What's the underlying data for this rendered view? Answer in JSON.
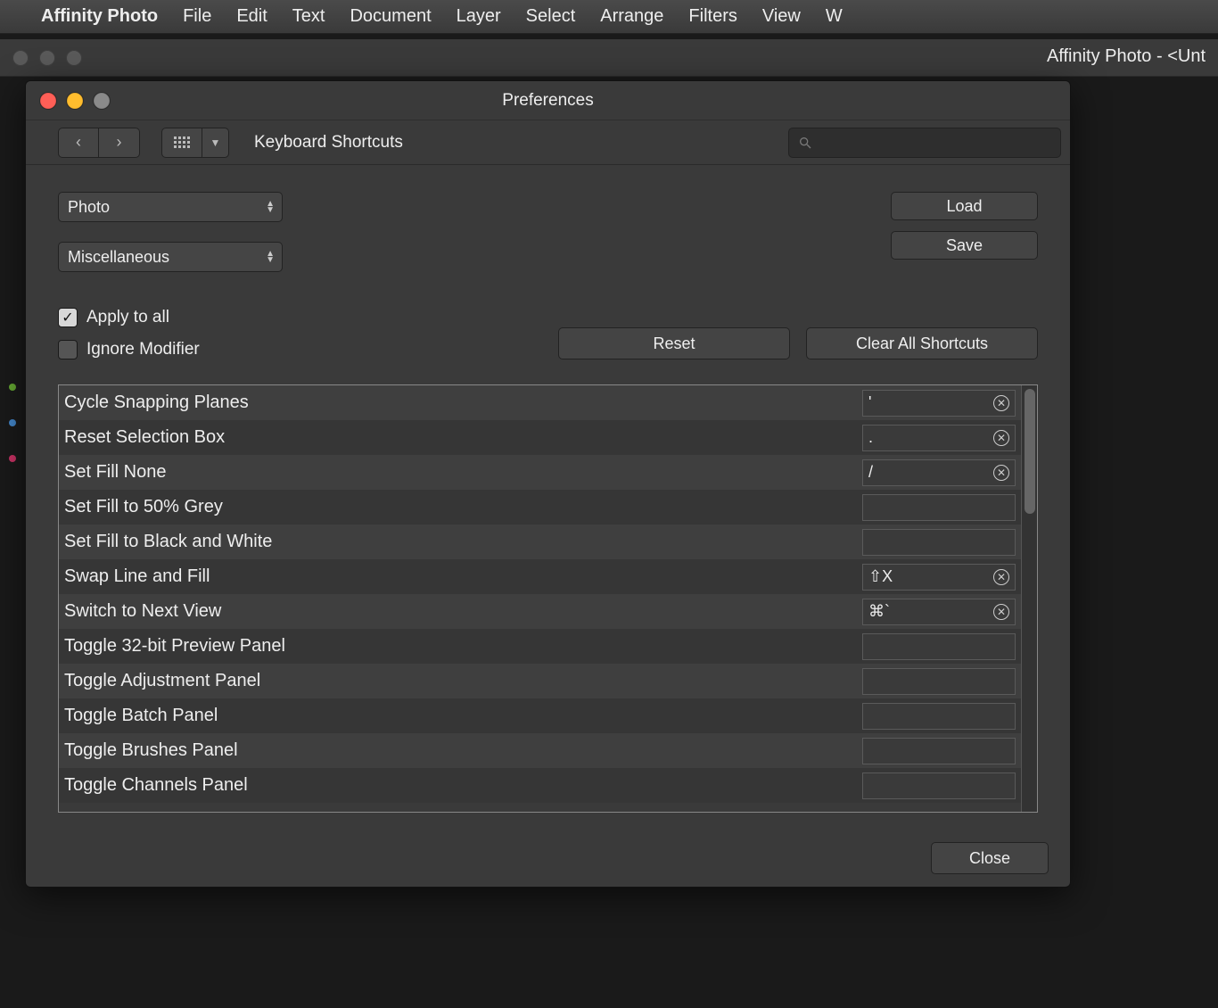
{
  "menubar": {
    "app": "Affinity Photo",
    "items": [
      "File",
      "Edit",
      "Text",
      "Document",
      "Layer",
      "Select",
      "Arrange",
      "Filters",
      "View",
      "W"
    ]
  },
  "mainwindow": {
    "title": "Affinity Photo - <Unt"
  },
  "prefs": {
    "title": "Preferences",
    "breadcrumb": "Keyboard Shortcuts",
    "search_placeholder": "",
    "persona_select": "Photo",
    "category_select": "Miscellaneous",
    "load_label": "Load",
    "save_label": "Save",
    "apply_all_label": "Apply to all",
    "apply_all_checked": true,
    "ignore_modifier_label": "Ignore Modifier",
    "ignore_modifier_checked": false,
    "reset_label": "Reset",
    "clear_all_label": "Clear All Shortcuts",
    "close_label": "Close",
    "shortcuts": [
      {
        "name": "Cycle Snapping Planes",
        "key": "'",
        "clearable": true
      },
      {
        "name": "Reset Selection Box",
        "key": ".",
        "clearable": true
      },
      {
        "name": "Set Fill None",
        "key": "/",
        "clearable": true
      },
      {
        "name": "Set Fill to 50% Grey",
        "key": "",
        "clearable": false
      },
      {
        "name": "Set Fill to Black and White",
        "key": "",
        "clearable": false
      },
      {
        "name": "Swap Line and Fill",
        "key": "⇧X",
        "clearable": true
      },
      {
        "name": "Switch to Next View",
        "key": "⌘`",
        "clearable": true
      },
      {
        "name": "Toggle 32-bit Preview Panel",
        "key": "",
        "clearable": false
      },
      {
        "name": "Toggle Adjustment Panel",
        "key": "",
        "clearable": false
      },
      {
        "name": "Toggle Batch Panel",
        "key": "",
        "clearable": false
      },
      {
        "name": "Toggle Brushes Panel",
        "key": "",
        "clearable": false
      },
      {
        "name": "Toggle Channels Panel",
        "key": "",
        "clearable": false
      }
    ]
  }
}
